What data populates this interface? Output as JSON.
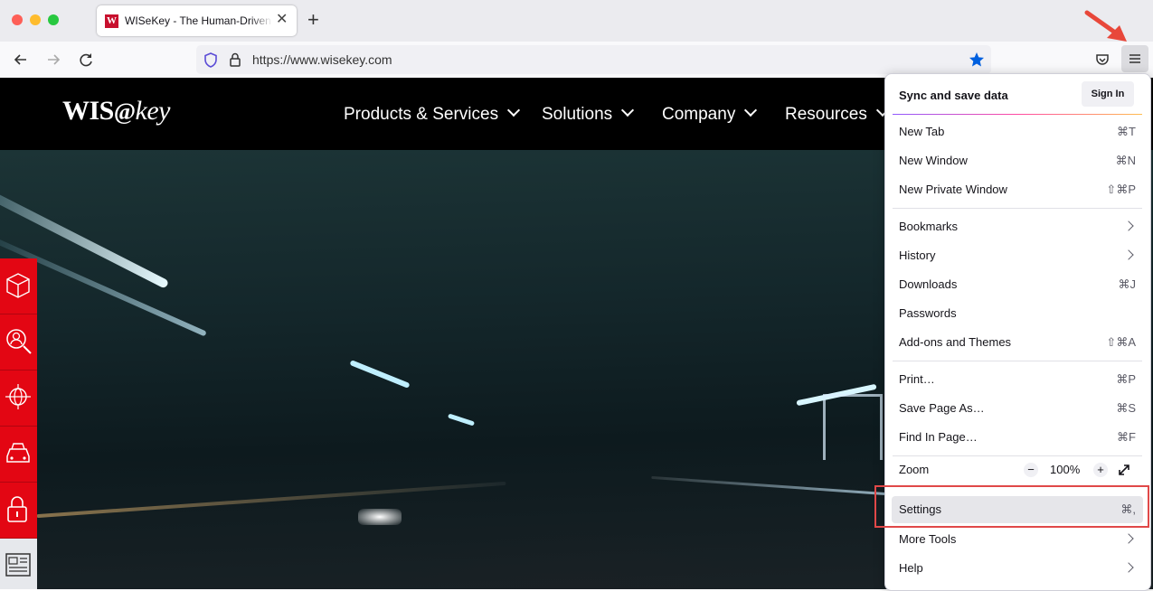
{
  "tab": {
    "title": "WISeKey - The Human-Driven Te",
    "favicon": "W",
    "close_glyph": "✕"
  },
  "toolbar": {
    "url": "https://www.wisekey.com",
    "new_tab_glyph": "+"
  },
  "site": {
    "logo_main": "WIS",
    "logo_at": "@",
    "logo_tail": "key",
    "nav": [
      "Products & Services",
      "Solutions",
      "Company",
      "Resources"
    ]
  },
  "menu": {
    "sync_label": "Sync and save data",
    "sign_in": "Sign In",
    "items": [
      {
        "label": "New Tab",
        "shortcut": "⌘T"
      },
      {
        "label": "New Window",
        "shortcut": "⌘N"
      },
      {
        "label": "New Private Window",
        "shortcut": "⇧⌘P"
      },
      {
        "label": "Bookmarks",
        "shortcut": ""
      },
      {
        "label": "History",
        "shortcut": ""
      },
      {
        "label": "Downloads",
        "shortcut": "⌘J"
      },
      {
        "label": "Passwords",
        "shortcut": ""
      },
      {
        "label": "Add-ons and Themes",
        "shortcut": "⇧⌘A"
      },
      {
        "label": "Print…",
        "shortcut": "⌘P"
      },
      {
        "label": "Save Page As…",
        "shortcut": "⌘S"
      },
      {
        "label": "Find In Page…",
        "shortcut": "⌘F"
      },
      {
        "label": "Zoom",
        "zoom_minus": "−",
        "zoom_value": "100%",
        "zoom_plus": "+"
      },
      {
        "label": "Settings",
        "shortcut": "⌘,"
      },
      {
        "label": "More Tools",
        "shortcut": ""
      },
      {
        "label": "Help",
        "shortcut": ""
      }
    ]
  },
  "colors": {
    "brand_red": "#e30613",
    "annotation_red": "#e04848",
    "accent_blue": "#0060df"
  },
  "icons": [
    "back-arrow-icon",
    "forward-arrow-icon",
    "reload-icon",
    "shield-icon",
    "lock-icon",
    "star-icon",
    "pocket-icon",
    "hamburger-icon",
    "red-arrow-icon",
    "cube-icon",
    "search-person-icon",
    "globe-network-icon",
    "car-icon",
    "padlock-icon",
    "newspaper-icon"
  ]
}
